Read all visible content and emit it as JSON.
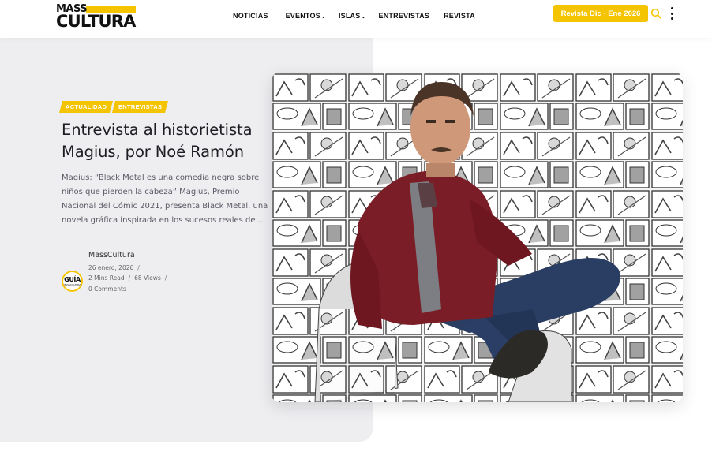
{
  "header": {
    "logo_top": "MASS",
    "logo_bottom": "CULTURA",
    "nav": [
      {
        "label": "NOTICIAS",
        "dropdown": false
      },
      {
        "label": "EVENTOS",
        "dropdown": true
      },
      {
        "label": "ISLAS",
        "dropdown": true
      },
      {
        "label": "ENTREVISTAS",
        "dropdown": false
      },
      {
        "label": "REVISTA",
        "dropdown": false
      }
    ],
    "magazine_button": "Revista Dic · Ene 2026",
    "icons": {
      "search": "search-icon",
      "more": "more-vertical-icon"
    }
  },
  "article": {
    "tags": [
      "ACTUALIDAD",
      "ENTREVISTAS"
    ],
    "title": "Entrevista al historietista Magius, por Noé Ramón",
    "excerpt": "Magius: “Black Metal es una comedia negra sobre niños que pierden la cabeza” Magius, Premio Nacional del Cómic 2021, presenta Black Metal, una novela gráfica inspirada en los sucesos reales de...",
    "author": "MassCultura",
    "avatar_text": {
      "line1": "GUÍA",
      "line2": "MASSCULTURA"
    },
    "date": "26 enero, 2026",
    "read_time": "2 Mins Read",
    "views": "68 Views",
    "comments": "0 Comments"
  },
  "colors": {
    "accent": "#f5c400",
    "hero_bg": "#eeeef1",
    "title_text": "#1c1c22",
    "body_text": "#5a5a66"
  }
}
